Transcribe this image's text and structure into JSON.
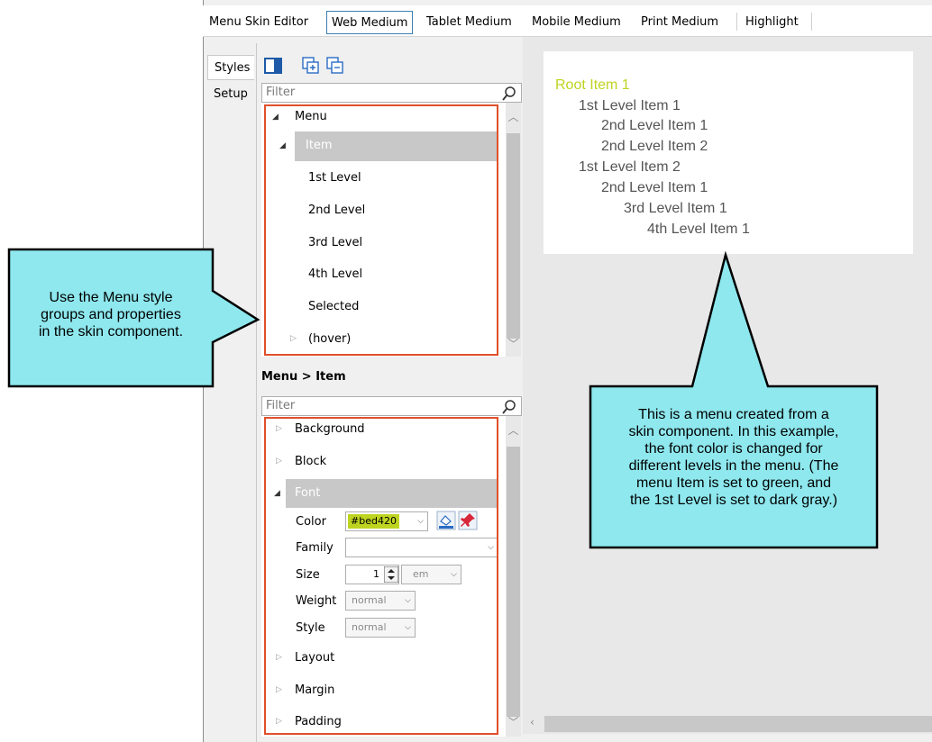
{
  "tabs": {
    "menu_skin_editor": "Menu Skin Editor",
    "web_medium": "Web Medium",
    "tablet_medium": "Tablet Medium",
    "mobile_medium": "Mobile Medium",
    "print_medium": "Print Medium",
    "highlight": "Highlight"
  },
  "side_tabs": {
    "styles": "Styles",
    "setup": "Setup"
  },
  "toolbar": {
    "icons": [
      "panel-toggle-icon",
      "expand-all-icon",
      "collapse-all-icon"
    ]
  },
  "styles_filter": {
    "placeholder": "Filter"
  },
  "styles_tree": {
    "menu": "Menu",
    "item": "Item",
    "first_level": "1st Level",
    "second_level": "2nd Level",
    "third_level": "3rd Level",
    "fourth_level": "4th Level",
    "selected": "Selected",
    "hover": "(hover)"
  },
  "properties": {
    "header": "Menu > Item",
    "filter_placeholder": "Filter",
    "groups": {
      "background": "Background",
      "block": "Block",
      "font": "Font",
      "layout": "Layout",
      "margin": "Margin",
      "padding": "Padding"
    },
    "font": {
      "color_label": "Color",
      "color_value": "#bed420",
      "family_label": "Family",
      "family_value": "",
      "size_label": "Size",
      "size_value": "1",
      "size_unit": "em",
      "weight_label": "Weight",
      "weight_value": "normal",
      "style_label": "Style",
      "style_value": "normal"
    }
  },
  "preview": {
    "root": "Root Item 1",
    "l1_a": "1st Level Item 1",
    "l2_a": "2nd Level Item 1",
    "l2_b": "2nd Level Item 2",
    "l1_b": "1st Level Item 2",
    "l2_c": "2nd Level Item 1",
    "l3_a": "3rd Level Item 1",
    "l4_a": "4th Level Item 1",
    "colors": {
      "root": "#bed420",
      "items": "#555555"
    }
  },
  "callouts": {
    "left_lines": [
      "Use the Menu style",
      "groups and properties",
      "in the skin component."
    ],
    "right_lines": [
      "This is a menu created from a",
      "skin component. In this example,",
      "the font color is changed for",
      "different levels in the menu. (The",
      "menu Item is set to green, and",
      "the 1st Level is set to dark gray.)"
    ]
  },
  "colors": {
    "callout_fill": "#8ee8ee",
    "highlight_box": "#e0502a",
    "selection": "#c8c8c8",
    "accent_tab": "#3c7fb1"
  }
}
